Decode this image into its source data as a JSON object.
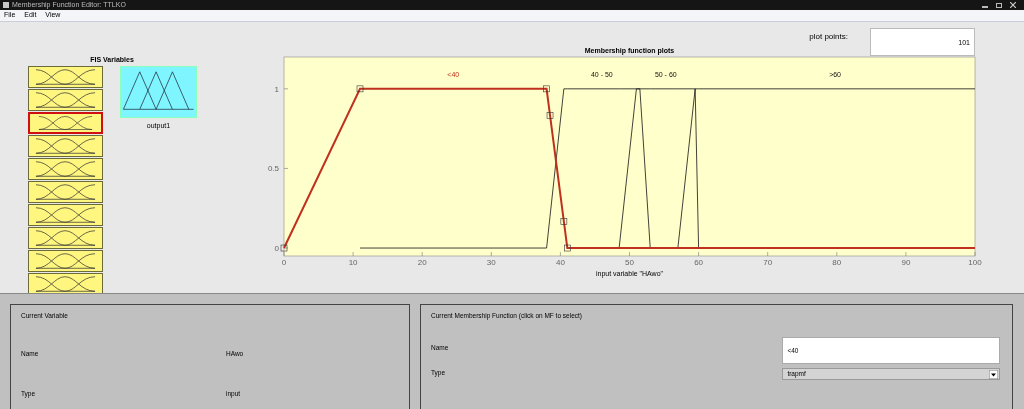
{
  "window": {
    "title": "Membership Function Editor: TTLKO"
  },
  "menu": [
    "File",
    "Edit",
    "View"
  ],
  "fis_variables": {
    "title": "FIS Variables",
    "inputs": [
      {
        "selected": false
      },
      {
        "selected": false
      },
      {
        "selected": true
      },
      {
        "selected": false
      },
      {
        "selected": false
      },
      {
        "selected": false
      },
      {
        "selected": false
      },
      {
        "selected": false
      },
      {
        "selected": false
      },
      {
        "selected": false
      }
    ],
    "outputs": [
      {
        "label": "output1",
        "selected": false
      }
    ]
  },
  "plot_points": {
    "label": "plot points:",
    "value": "101"
  },
  "plot": {
    "curves": [
      {
        "selected": true
      },
      {
        "selected": false
      },
      {
        "selected": false
      },
      {
        "selected": false
      }
    ],
    "chart_data": {
      "type": "line",
      "title": "Membership function plots",
      "xlabel": "input variable \"HAwo\"",
      "x": [
        0,
        11,
        38,
        38.5,
        40.5,
        41,
        48.5,
        51,
        51.5,
        53,
        57,
        59.5,
        60,
        100
      ],
      "series": [
        {
          "name": "<40",
          "values": [
            0,
            1,
            1,
            0.833,
            0.167,
            0,
            0,
            0,
            0,
            0,
            0,
            0,
            0,
            0
          ]
        },
        {
          "name": "40 - 50",
          "values": [
            null,
            0,
            0,
            0.2,
            1,
            1,
            1,
            1,
            1,
            0,
            null,
            null,
            null,
            null
          ]
        },
        {
          "name": "50 - 60",
          "values": [
            null,
            null,
            null,
            null,
            null,
            null,
            0,
            1,
            1,
            1,
            1,
            1,
            0,
            null
          ]
        },
        {
          "name": ">60",
          "values": [
            null,
            null,
            null,
            null,
            null,
            null,
            null,
            null,
            null,
            null,
            0,
            1,
            1,
            1
          ]
        }
      ],
      "xlim": [
        0,
        100
      ],
      "ylim": [
        -0.05,
        1.2
      ],
      "xticks": [
        0,
        10,
        20,
        30,
        40,
        50,
        60,
        70,
        80,
        90,
        100
      ],
      "yticks": [
        0,
        0.5,
        1
      ]
    }
  },
  "current_variable": {
    "title": "Current Variable",
    "name_label": "Name",
    "name": "HAwo",
    "type_label": "Type",
    "type": "input"
  },
  "current_mf": {
    "title": "Current Membership Function (click on MF to select)",
    "name_label": "Name",
    "name": "<40",
    "type_label": "Type",
    "type": "trapmf"
  }
}
